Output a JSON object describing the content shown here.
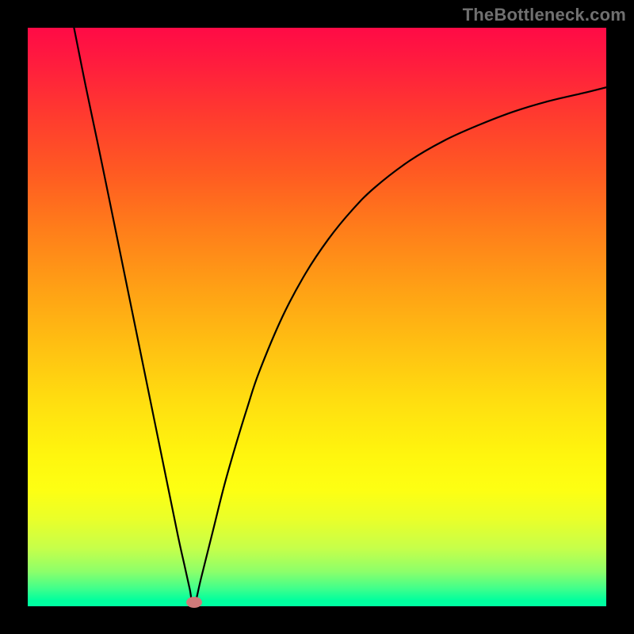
{
  "watermark": "TheBottleneck.com",
  "chart_data": {
    "type": "line",
    "title": "",
    "xlabel": "",
    "ylabel": "",
    "xlim": [
      0,
      100
    ],
    "ylim": [
      0,
      100
    ],
    "grid": false,
    "legend": false,
    "series": [
      {
        "name": "left-branch",
        "x": [
          8,
          10,
          12,
          14,
          16,
          18,
          20,
          22,
          24,
          26,
          27,
          28,
          28.7
        ],
        "y": [
          100,
          90,
          80.5,
          70.8,
          61,
          51.2,
          41.4,
          31.6,
          21.8,
          12,
          7.5,
          3,
          0
        ]
      },
      {
        "name": "right-branch",
        "x": [
          28.7,
          30,
          32,
          34,
          36,
          38,
          40,
          44,
          48,
          52,
          56,
          60,
          66,
          72,
          78,
          84,
          90,
          96,
          100
        ],
        "y": [
          0,
          5,
          13,
          21,
          28,
          34.5,
          40.5,
          50,
          57.5,
          63.5,
          68.4,
          72.4,
          77,
          80.5,
          83.2,
          85.5,
          87.3,
          88.7,
          89.7
        ]
      }
    ],
    "marker": {
      "x": 28.7,
      "y": 0.7,
      "shape": "ellipse",
      "color": "#cf7a7a"
    },
    "background_gradient": {
      "type": "vertical",
      "stops": [
        {
          "pos": 0,
          "color": "#ff0a46"
        },
        {
          "pos": 50,
          "color": "#ffb014"
        },
        {
          "pos": 80,
          "color": "#fdff13"
        },
        {
          "pos": 100,
          "color": "#00ffa2"
        }
      ]
    }
  }
}
